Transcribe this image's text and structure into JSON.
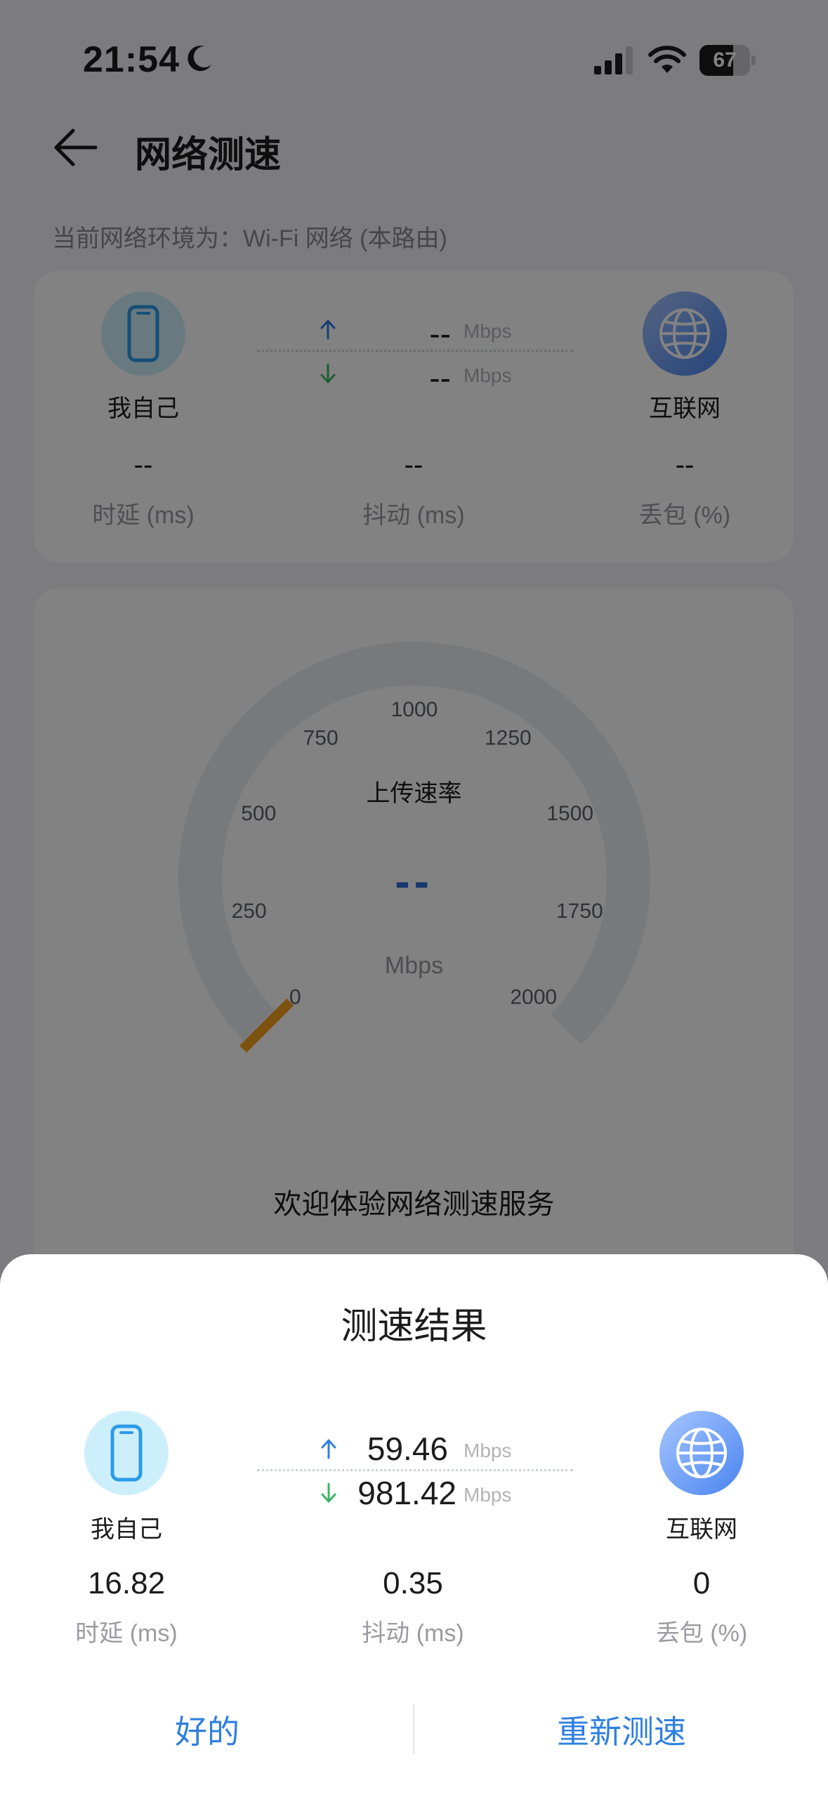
{
  "status_bar": {
    "time": "21:54",
    "battery": "67",
    "battery_level": 0.67
  },
  "header": {
    "title": "网络测速"
  },
  "network_env": "当前网络环境为：Wi-Fi 网络 (本路由)",
  "test_card": {
    "left_label": "我自己",
    "right_label": "互联网",
    "upload_value": "--",
    "download_value": "--",
    "unit": "Mbps",
    "metrics": [
      {
        "value": "--",
        "label": "时延 (ms)"
      },
      {
        "value": "--",
        "label": "抖动 (ms)"
      },
      {
        "value": "--",
        "label": "丢包 (%)"
      }
    ]
  },
  "gauge": {
    "ticks": [
      "0",
      "250",
      "500",
      "750",
      "1000",
      "1250",
      "1500",
      "1750",
      "2000"
    ],
    "label": "上传速率",
    "value": "--",
    "unit": "Mbps",
    "needle_value": 0
  },
  "welcome_text": "欢迎体验网络测速服务",
  "result_sheet": {
    "title": "测速结果",
    "left_label": "我自己",
    "right_label": "互联网",
    "upload_value": "59.46",
    "download_value": "981.42",
    "unit": "Mbps",
    "metrics": [
      {
        "value": "16.82",
        "label": "时延 (ms)"
      },
      {
        "value": "0.35",
        "label": "抖动 (ms)"
      },
      {
        "value": "0",
        "label": "丢包 (%)"
      }
    ],
    "ok_button": "好的",
    "retest_button": "重新测速"
  },
  "colors": {
    "accent": "#2f7fe0",
    "upload_arrow": "#2f7fe0",
    "download_arrow": "#3cb563",
    "needle": "#f5a11c"
  }
}
